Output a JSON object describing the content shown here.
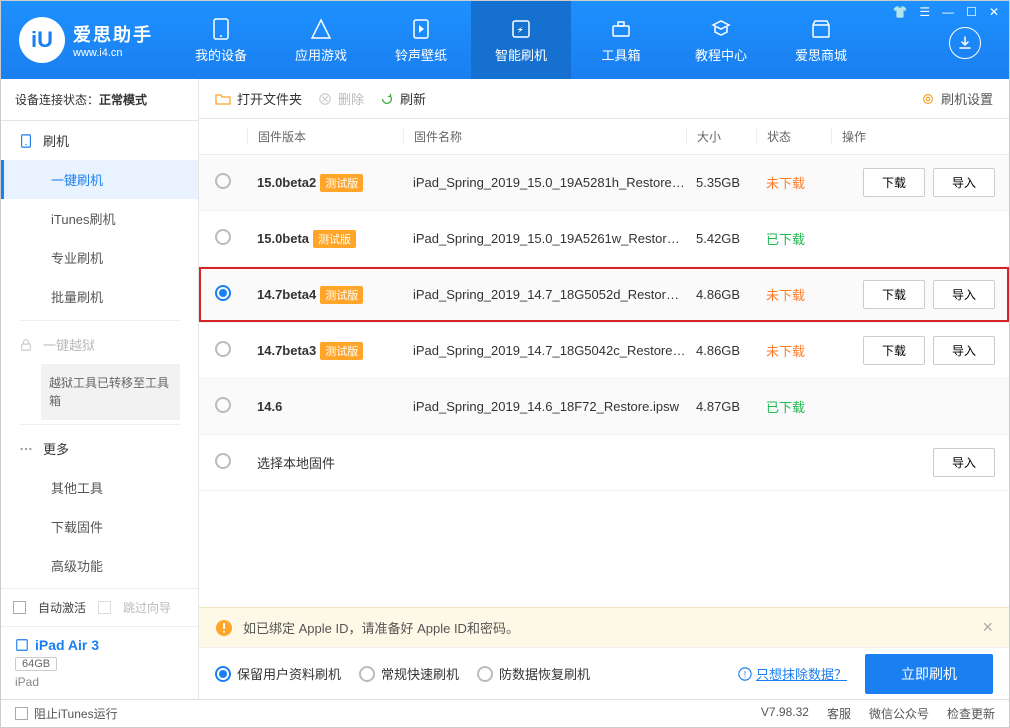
{
  "logo": {
    "title": "爱思助手",
    "url": "www.i4.cn",
    "mark": "iU"
  },
  "nav": [
    {
      "label": "我的设备",
      "icon": "device"
    },
    {
      "label": "应用游戏",
      "icon": "app"
    },
    {
      "label": "铃声壁纸",
      "icon": "ring"
    },
    {
      "label": "智能刷机",
      "icon": "flash",
      "active": true
    },
    {
      "label": "工具箱",
      "icon": "tool"
    },
    {
      "label": "教程中心",
      "icon": "tutorial"
    },
    {
      "label": "爱思商城",
      "icon": "store"
    }
  ],
  "conn_status": {
    "label": "设备连接状态：",
    "value": "正常模式"
  },
  "sidebar": {
    "grp1": {
      "title": "刷机",
      "items": [
        "一键刷机",
        "iTunes刷机",
        "专业刷机",
        "批量刷机"
      ]
    },
    "jailbreak": {
      "title": "一键越狱",
      "note": "越狱工具已转移至工具箱"
    },
    "more": {
      "title": "更多",
      "items": [
        "其他工具",
        "下载固件",
        "高级功能"
      ]
    }
  },
  "auto_activate": {
    "label": "自动激活",
    "skip": "跳过向导"
  },
  "device": {
    "name": "iPad Air 3",
    "storage": "64GB",
    "type": "iPad"
  },
  "toolbar": {
    "open": "打开文件夹",
    "delete": "删除",
    "refresh": "刷新",
    "settings": "刷机设置"
  },
  "cols": {
    "version": "固件版本",
    "name": "固件名称",
    "size": "大小",
    "status": "状态",
    "action": "操作"
  },
  "rows": [
    {
      "version": "15.0beta2",
      "beta": true,
      "name": "iPad_Spring_2019_15.0_19A5281h_Restore.ip…",
      "size": "5.35GB",
      "status": "not",
      "download": true,
      "import": true,
      "selected": false,
      "highlight": false
    },
    {
      "version": "15.0beta",
      "beta": true,
      "name": "iPad_Spring_2019_15.0_19A5261w_Restore.i…",
      "size": "5.42GB",
      "status": "done",
      "download": false,
      "import": false,
      "selected": false,
      "highlight": false
    },
    {
      "version": "14.7beta4",
      "beta": true,
      "name": "iPad_Spring_2019_14.7_18G5052d_Restore.i…",
      "size": "4.86GB",
      "status": "not",
      "download": true,
      "import": true,
      "selected": true,
      "highlight": true
    },
    {
      "version": "14.7beta3",
      "beta": true,
      "name": "iPad_Spring_2019_14.7_18G5042c_Restore.ip…",
      "size": "4.86GB",
      "status": "not",
      "download": true,
      "import": true,
      "selected": false,
      "highlight": false
    },
    {
      "version": "14.6",
      "beta": false,
      "name": "iPad_Spring_2019_14.6_18F72_Restore.ipsw",
      "size": "4.87GB",
      "status": "done",
      "download": false,
      "import": false,
      "selected": false,
      "highlight": false
    },
    {
      "version": "选择本地固件",
      "beta": false,
      "local": true,
      "name": "",
      "size": "",
      "status": "",
      "download": false,
      "import": true,
      "selected": false,
      "highlight": false
    }
  ],
  "status_text": {
    "not": "未下载",
    "done": "已下载"
  },
  "btn_text": {
    "download": "下载",
    "import": "导入"
  },
  "beta_tag": "测试版",
  "alert": "如已绑定 Apple ID，请准备好 Apple ID和密码。",
  "flash_options": [
    "保留用户资料刷机",
    "常规快速刷机",
    "防数据恢复刷机"
  ],
  "erase_link": "只想抹除数据？",
  "flash_btn": "立即刷机",
  "footer": {
    "block": "阻止iTunes运行",
    "version": "V7.98.32",
    "service": "客服",
    "wechat": "微信公众号",
    "update": "检查更新"
  }
}
